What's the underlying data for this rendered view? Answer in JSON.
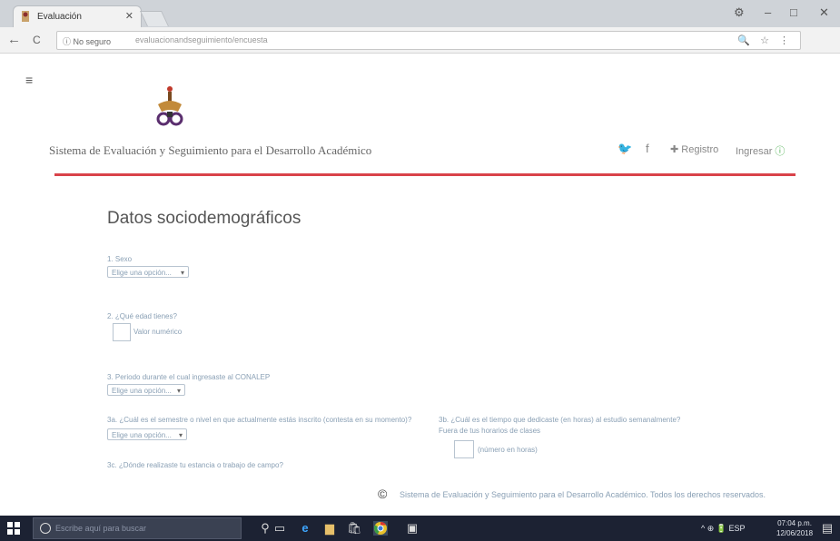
{
  "browser": {
    "tab_title": "Evaluación",
    "tab_close": "✕",
    "window_controls": [
      "⚙",
      "–",
      "□",
      "✕"
    ],
    "security_label": "ⓘ No seguro",
    "url": "evaluacionandseguimiento/encuesta",
    "back_glyph": "←",
    "reload_glyph": "C",
    "omnibox_icons": "🔍 ☆ ⋮"
  },
  "page": {
    "menu_glyph": "≡",
    "site_title": "Sistema de Evaluación y Seguimiento para el Desarrollo Académico",
    "social": {
      "twitter": "🐦",
      "facebook": "f"
    },
    "register_label": "✚ Registro",
    "login_label": "Ingresar",
    "login_glyph": "ⓘ",
    "accent_color": "#d9434a"
  },
  "form": {
    "title": "Datos sociodemográficos",
    "questions": [
      {
        "label": "1. Sexo",
        "select_placeholder": "Elige una opción..."
      },
      {
        "label": "2. ¿Qué edad tienes?",
        "hint": "Valor numérico"
      },
      {
        "label": "3. Periodo durante el cual ingresaste al CONALEP",
        "select_placeholder": "Elige una opción..."
      },
      {
        "label": "3a. ¿Cuál es el semestre o nivel en que actualmente estás inscrito (contesta en su momento)?",
        "select_placeholder": "Elige una opción..."
      },
      {
        "label": "3b. ¿Cuál es el tiempo que dedicaste (en horas) al estudio semanalmente?",
        "sub": "Fuera de tus horarios de clases",
        "hint": "(número en horas)"
      },
      {
        "label": "3c. ¿Dónde realizaste tu estancia o trabajo de campo?"
      }
    ]
  },
  "footer": {
    "icon": "©",
    "text": "Sistema de Evaluación y Seguimiento para el Desarrollo Académico. Todos los derechos reservados."
  },
  "taskbar": {
    "search_placeholder": "Escribe aquí para buscar",
    "tray_text": "^ ⊕ 🔋 ESP",
    "time": "07:04 p.m.",
    "date": "12/06/2018"
  }
}
